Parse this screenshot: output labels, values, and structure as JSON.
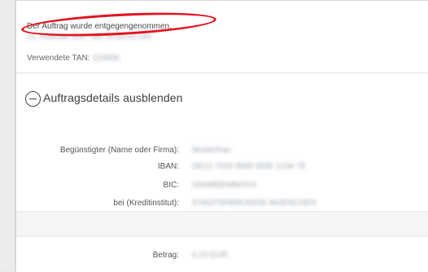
{
  "confirmation": {
    "message": "Der Auftrag wurde entgegengenommen.",
    "date": "21. Februar 2017 um 11:33:04 Uhr",
    "tan_label": "Verwendete TAN:",
    "tan_value": "123456",
    "highlight_color": "#e2141f"
  },
  "toggle": {
    "icon": "minus-circle-icon",
    "label": "Auftragsdetails ausblenden"
  },
  "details": {
    "rows": [
      {
        "label": "Begünstigter (Name oder Firma):",
        "value": "Musterfrau"
      },
      {
        "label": "IBAN:",
        "value": "DE12 7015 0000 0000 1234 78"
      },
      {
        "label": "BIC:",
        "value": "SSKMDEMMXXX"
      },
      {
        "label": "bei (Kreditinstitut):",
        "value": "STADTSPARKASSE MUENCHEN"
      },
      {
        "label": "Betrag:",
        "value": "0,10 EUR"
      }
    ]
  }
}
